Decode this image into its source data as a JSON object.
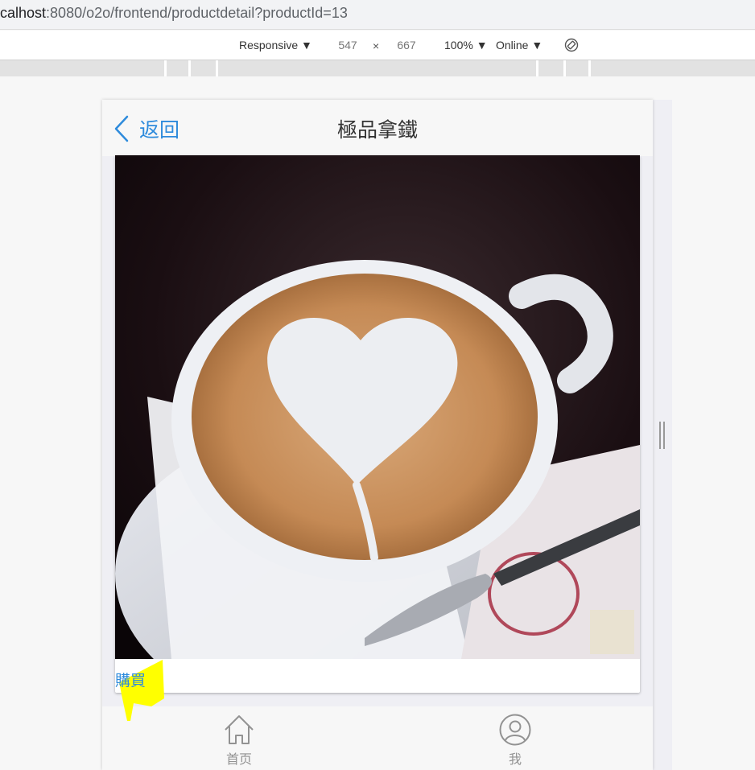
{
  "browser": {
    "url_host": "calhost",
    "url_rest": ":8080/o2o/frontend/productdetail?productId=13"
  },
  "device_toolbar": {
    "device_label": "Responsive ▼",
    "width_value": "547",
    "height_value": "667",
    "times_sign": "×",
    "zoom_label": "100% ▼",
    "network_label": "Online ▼"
  },
  "header": {
    "back_label": "返回",
    "title": "極品拿鐵"
  },
  "product": {
    "buy_label": "購買"
  },
  "tabbar": {
    "items": [
      {
        "label": "首页",
        "icon": "home-icon"
      },
      {
        "label": "我",
        "icon": "user-icon"
      }
    ]
  },
  "colors": {
    "accent": "#2e8bdc",
    "highlight": "#ffff00",
    "tab_inactive": "#929292"
  }
}
